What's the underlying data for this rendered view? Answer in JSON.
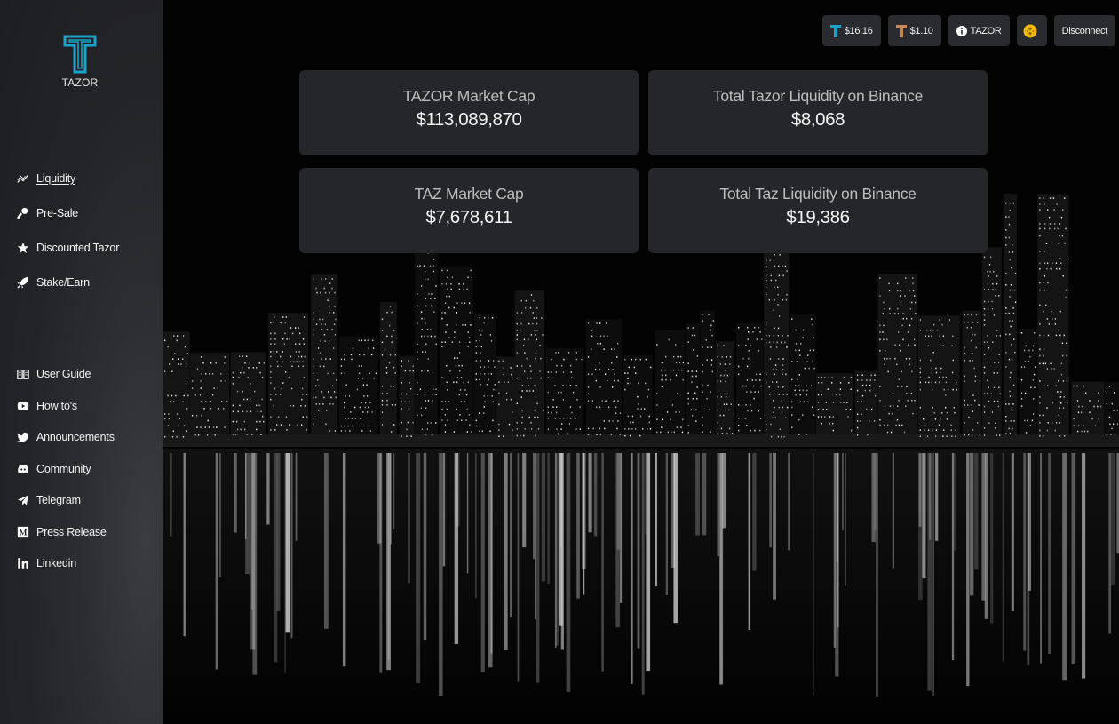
{
  "brand": {
    "name": "TAZOR",
    "accent": "#19a3c8"
  },
  "sidebar": {
    "main": [
      {
        "label": "Liquidity",
        "icon": "chart-line-icon",
        "active": true
      },
      {
        "label": "Pre-Sale",
        "icon": "key-icon"
      },
      {
        "label": "Discounted Tazor",
        "icon": "star-icon"
      },
      {
        "label": "Stake/Earn",
        "icon": "rocket-icon"
      }
    ],
    "links": [
      {
        "label": "User Guide",
        "icon": "book-icon"
      },
      {
        "label": "How to's",
        "icon": "youtube-icon"
      },
      {
        "label": "Announcements",
        "icon": "twitter-icon"
      },
      {
        "label": "Community",
        "icon": "discord-icon"
      },
      {
        "label": "Telegram",
        "icon": "telegram-icon"
      },
      {
        "label": "Press Release",
        "icon": "medium-icon"
      },
      {
        "label": "Linkedin",
        "icon": "linkedin-icon"
      }
    ]
  },
  "topbar": {
    "tazor_price": "$16.16",
    "taz_price": "$1.10",
    "token_label": "TAZOR",
    "disconnect_label": "Disconnect"
  },
  "stats": {
    "tazor_market_cap": {
      "title": "TAZOR Market Cap",
      "value": "$113,089,870"
    },
    "tazor_liquidity": {
      "title": "Total Tazor Liquidity on Binance",
      "value": "$8,068"
    },
    "taz_market_cap": {
      "title": "TAZ Market Cap",
      "value": "$7,678,611"
    },
    "taz_liquidity": {
      "title": "Total Taz Liquidity on Binance",
      "value": "$19,386"
    }
  },
  "colors": {
    "sidebar_bg": "#2a2b2e",
    "card_bg": "#25262a",
    "bnb_coin": "#f0b90b"
  }
}
